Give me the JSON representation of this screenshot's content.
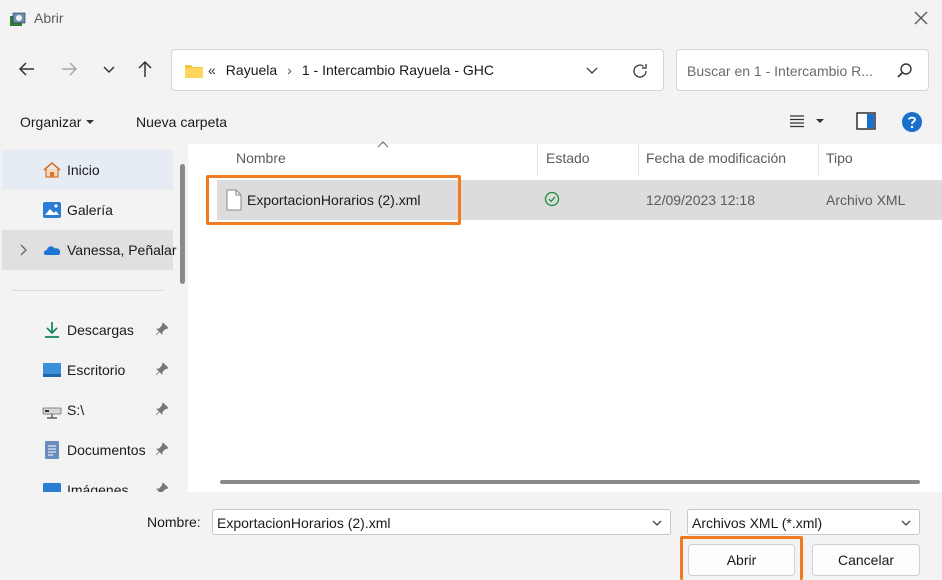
{
  "window": {
    "title": "Abrir"
  },
  "address": {
    "overflow": "«",
    "crumbs": [
      "Rayuela",
      "1 - Intercambio Rayuela - GHC"
    ],
    "separator": "›"
  },
  "search": {
    "placeholder": "Buscar en 1 - Intercambio R..."
  },
  "toolbar": {
    "organize_label": "Organizar",
    "new_folder_label": "Nueva carpeta"
  },
  "sidebar": {
    "items": [
      {
        "label": "Inicio",
        "icon": "home-icon"
      },
      {
        "label": "Galería",
        "icon": "gallery-icon"
      },
      {
        "label": "Vanessa, Peñalar",
        "icon": "onedrive-cloud-icon"
      },
      {
        "label": "Descargas",
        "icon": "download-icon",
        "pinned": true
      },
      {
        "label": "Escritorio",
        "icon": "desktop-icon",
        "pinned": true
      },
      {
        "label": "S:\\",
        "icon": "network-drive-icon",
        "pinned": true
      },
      {
        "label": "Documentos",
        "icon": "documents-icon",
        "pinned": true
      },
      {
        "label": "Imágenes",
        "icon": "pictures-icon",
        "pinned": true
      }
    ]
  },
  "columns": {
    "name": "Nombre",
    "status": "Estado",
    "modified": "Fecha de modificación",
    "type": "Tipo"
  },
  "files": [
    {
      "name": "ExportacionHorarios (2).xml",
      "status_icon": "synced-check-icon",
      "modified": "12/09/2023 12:18",
      "type": "Archivo XML"
    }
  ],
  "footer": {
    "name_label": "Nombre:",
    "name_value": "ExportacionHorarios (2).xml",
    "filter_value": "Archivos XML (*.xml)",
    "open_label": "Abrir",
    "cancel_label": "Cancelar"
  },
  "colors": {
    "highlight": "#f07b22",
    "accent": "#0067c0",
    "selected_row": "#dcdcdc"
  }
}
